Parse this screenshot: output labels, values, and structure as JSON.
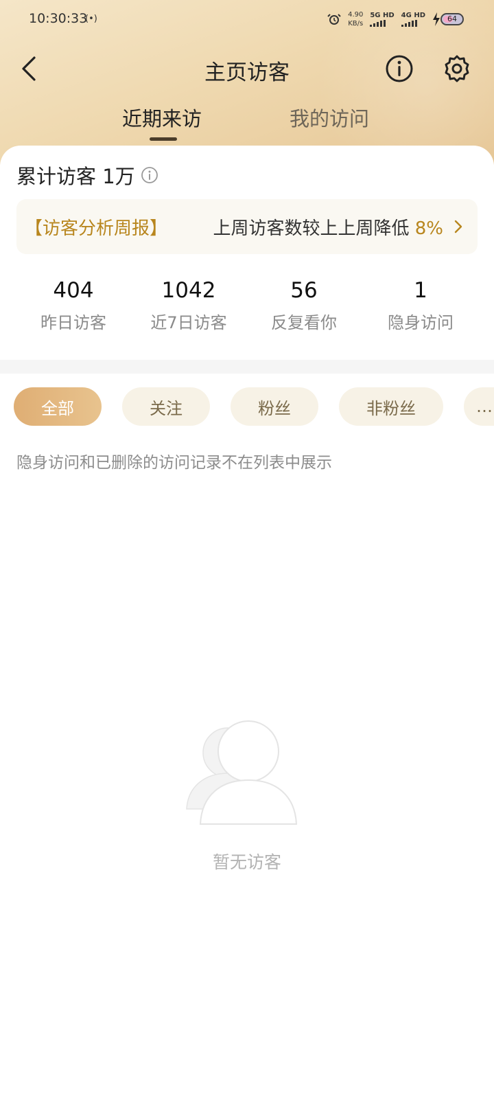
{
  "status_bar": {
    "time": "10:30:33",
    "signal_indicator": "(•)",
    "speed_value": "4.90",
    "speed_unit": "KB/s",
    "net1": "5G HD",
    "net2": "4G HD",
    "battery": "64"
  },
  "nav": {
    "title": "主页访客",
    "back_icon": "chevron-left-icon",
    "info_icon": "info-icon",
    "settings_icon": "gear-icon"
  },
  "tabs": [
    {
      "label": "近期来访",
      "active": true
    },
    {
      "label": "我的访问",
      "active": false
    }
  ],
  "summary": {
    "total_label": "累计访客 1万"
  },
  "report": {
    "tag": "【访客分析周报】",
    "desc": "上周访客数较上上周降低",
    "percent": "8%"
  },
  "stats": [
    {
      "value": "404",
      "label": "昨日访客"
    },
    {
      "value": "1042",
      "label": "近7日访客"
    },
    {
      "value": "56",
      "label": "反复看你"
    },
    {
      "value": "1",
      "label": "隐身访问"
    }
  ],
  "filters": [
    {
      "label": "全部",
      "active": true
    },
    {
      "label": "关注",
      "active": false
    },
    {
      "label": "粉丝",
      "active": false
    },
    {
      "label": "非粉丝",
      "active": false
    },
    {
      "label": "…",
      "active": false
    }
  ],
  "notice": "隐身访问和已删除的访问记录不在列表中展示",
  "empty_state": {
    "text": "暂无访客",
    "icon": "user-placeholder-icon"
  },
  "colors": {
    "accent": "#b8861e",
    "chip_active": "#dfae74",
    "header_bg": "#efd9b0"
  }
}
